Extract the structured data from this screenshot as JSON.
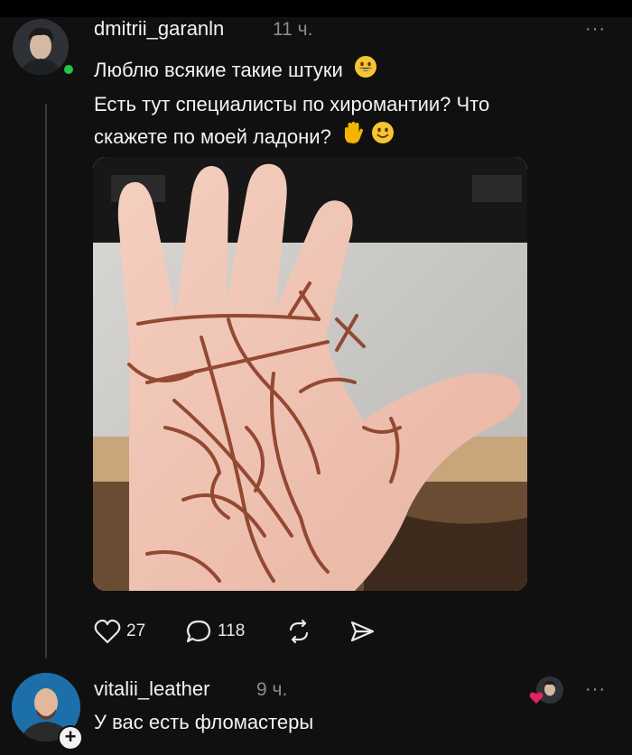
{
  "post": {
    "author": "dmitrii_garanln",
    "time": "11 ч.",
    "more": "···",
    "lines": [
      "Люблю всякие такие штуки",
      "Есть тут специалисты по хиромантии? Что",
      "скажете по моей ладони?"
    ],
    "likes": "27",
    "comments": "118",
    "icons": [
      "heart-icon",
      "comment-icon",
      "repost-icon",
      "share-icon"
    ]
  },
  "reply": {
    "author": "vitalii_leather",
    "time": "9 ч.",
    "more": "···",
    "text": "У вас есть фломастеры"
  },
  "colors": {
    "background": "#101010",
    "online": "#26c24a",
    "like": "#e0245e"
  }
}
